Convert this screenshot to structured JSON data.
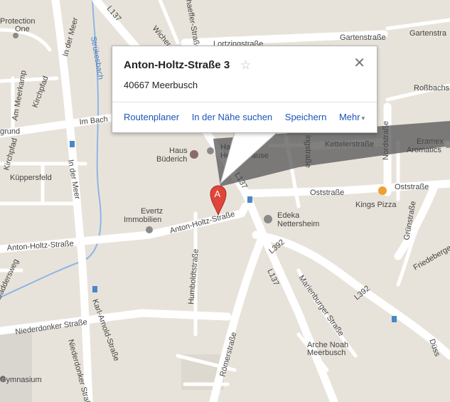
{
  "info_window": {
    "title": "Anton-Holtz-Straße 3",
    "star_icon": "☆",
    "close_icon": "✕",
    "address": "40667 Meerbusch",
    "links": [
      "Routenplaner",
      "In der Nähe suchen",
      "Speichern",
      "Mehr"
    ],
    "more_caret": "▾"
  },
  "marker": {
    "label": "A",
    "color": "#e0453a"
  },
  "colors": {
    "land": "#e8e3da",
    "road": "#ffffff",
    "water": "#8fb4e8",
    "shadow": "#555555"
  },
  "map_labels": {
    "protection": "Protection",
    "one": "One",
    "l137_top": "L137",
    "in_der_meer_top": "In der Meer",
    "strukesbach": "Strükesbach",
    "schaeffer": "haeffer-Straße",
    "wicher": "Wicher",
    "lortzing": "Lortzingstraße",
    "gartenstrasse_1": "Gartenstraße",
    "gartenstrasse_2": "Gartenstra",
    "rossbach": "Roßbachs",
    "am_meerkamp": "Am Meerkamp",
    "kirchpfad": "Kirchpfad",
    "im_bachgrund_1": "Im Bach",
    "im_bachgrund_2": "grund",
    "in_der_meer_mid": "In der Meer",
    "kirchpfad_2": "Kirchpfad",
    "kueppersfeld": "Küppersfeld",
    "haus": "Haus",
    "buederich": "Büderich",
    "hautarzt_1": "Hautär",
    "hautarzt_2": "Helen",
    "hautarzt_3": "ause",
    "l137_mid": "L137",
    "nordstrasse": "Nordstraße",
    "kettelerstrasse": "Kettelerstraße",
    "eramex": "Eramex",
    "aromatics": "Aromatics",
    "ringstrasse": "ingstraße",
    "oststrasse_1": "Oststraße",
    "oststrasse_2": "Oststraße",
    "kings_pizza": "Kings Pizza",
    "evertz": "Evertz",
    "immobilien": "Immobilien",
    "anton_holtz_left": "Anton-Holtz-Straße",
    "anton_holtz_right": "Anton-Holtz-Straße",
    "edeka": "Edeka",
    "nettersheim": "Nettersheim",
    "l392_1": "L392",
    "gruenstrasse": "Grünstraße",
    "friedeberger": "Friedeberger Weg",
    "daddersweg": "Daddersweg",
    "humboldtstrasse": "Humboldtstraße",
    "l137_low": "L137",
    "marienburger": "Marienburger Straße",
    "l392_2": "L392",
    "niederdonker_1": "Niederdonker Straße",
    "karl_arnold": "Karl-Arnold-Straße",
    "roemerstrasse": "Römerstraße",
    "arche_noah": "Arche Noah",
    "meerbusch": "Meerbusch",
    "niederdonker_2": "Niederdonker Straße",
    "gymnasium": "Gymnasium",
    "duesseldorf": "Düss"
  }
}
